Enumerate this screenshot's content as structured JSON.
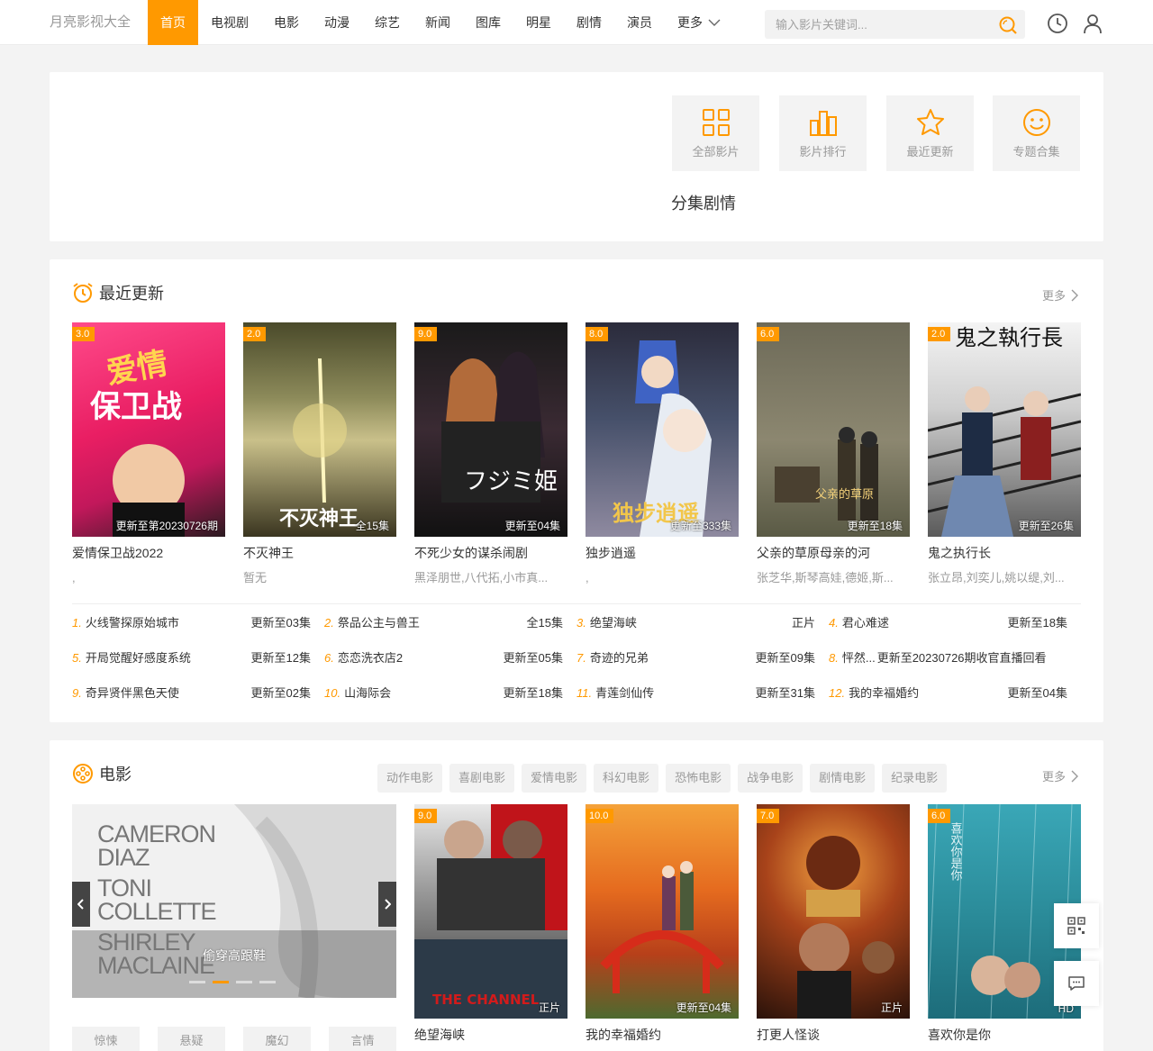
{
  "header": {
    "logo": "月亮影视大全",
    "nav": [
      "首页",
      "电视剧",
      "电影",
      "动漫",
      "综艺",
      "新闻",
      "图库",
      "明星",
      "剧情",
      "演员"
    ],
    "more_label": "更多",
    "search_placeholder": "输入影片关键词..."
  },
  "quick": {
    "buttons": [
      "全部影片",
      "影片排行",
      "最近更新",
      "专题合集"
    ],
    "title": "分集剧情"
  },
  "recent": {
    "title": "最近更新",
    "more": "更多",
    "cards": [
      {
        "score": "3.0",
        "ep": "更新至第20230726期",
        "name": "爱情保卫战2022",
        "actor": ","
      },
      {
        "score": "2.0",
        "ep": "全15集",
        "name": "不灭神王",
        "actor": "暂无"
      },
      {
        "score": "9.0",
        "ep": "更新至04集",
        "name": "不死少女的谋杀闹剧",
        "actor": "黑泽朋世,八代拓,小市真..."
      },
      {
        "score": "8.0",
        "ep": "更新至333集",
        "name": "独步逍遥",
        "actor": ","
      },
      {
        "score": "6.0",
        "ep": "更新至18集",
        "name": "父亲的草原母亲的河",
        "actor": "张芝华,斯琴高娃,德姬,斯..."
      },
      {
        "score": "2.0",
        "ep": "更新至26集",
        "name": "鬼之执行长",
        "actor": "张立昂,刘奕儿,姚以缇,刘..."
      }
    ],
    "list": [
      {
        "rank": "1.",
        "name": "火线警探原始城市",
        "status": "更新至03集"
      },
      {
        "rank": "2.",
        "name": "祭品公主与兽王",
        "status": "全15集"
      },
      {
        "rank": "3.",
        "name": "绝望海峡",
        "status": "正片"
      },
      {
        "rank": "4.",
        "name": "君心难逑",
        "status": "更新至18集"
      },
      {
        "rank": "5.",
        "name": "开局觉醒好感度系统",
        "status": "更新至12集"
      },
      {
        "rank": "6.",
        "name": "恋恋洗衣店2",
        "status": "更新至05集"
      },
      {
        "rank": "7.",
        "name": "奇迹的兄弟",
        "status": "更新至09集"
      },
      {
        "rank": "8.",
        "name": "怦然...",
        "status": "更新至20230726期收官直播回看"
      },
      {
        "rank": "9.",
        "name": "奇异贤伴黑色天使",
        "status": "更新至02集"
      },
      {
        "rank": "10.",
        "name": "山海际会",
        "status": "更新至18集"
      },
      {
        "rank": "11.",
        "name": "青莲剑仙传",
        "status": "更新至31集"
      },
      {
        "rank": "12.",
        "name": "我的幸福婚约",
        "status": "更新至04集"
      }
    ]
  },
  "movie": {
    "title": "电影",
    "more": "更多",
    "tags": [
      "动作电影",
      "喜剧电影",
      "爱情电影",
      "科幻电影",
      "恐怖电影",
      "战争电影",
      "剧情电影",
      "纪录电影"
    ],
    "slider_caption": "偷穿高跟鞋",
    "slider_text": [
      "CAMERON",
      "DIAZ",
      "TONI",
      "COLLETTE",
      "SHIRLEY",
      "MACLAINE"
    ],
    "genres": [
      "惊悚",
      "悬疑",
      "魔幻",
      "言情"
    ],
    "cards": [
      {
        "score": "9.0",
        "ep": "正片",
        "name": "绝望海峡"
      },
      {
        "score": "10.0",
        "ep": "更新至04集",
        "name": "我的幸福婚约"
      },
      {
        "score": "7.0",
        "ep": "正片",
        "name": "打更人怪谈"
      },
      {
        "score": "6.0",
        "ep": "HD",
        "name": "喜欢你是你"
      }
    ]
  }
}
